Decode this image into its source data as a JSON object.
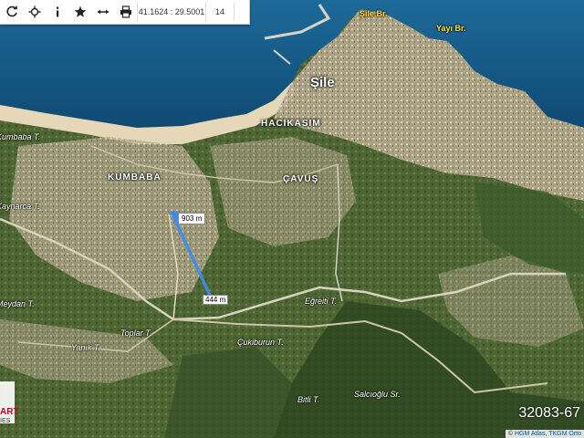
{
  "toolbar": {
    "buttons": [
      {
        "name": "refresh-icon"
      },
      {
        "name": "locate-icon"
      },
      {
        "name": "info-icon"
      },
      {
        "name": "favorite-icon"
      },
      {
        "name": "measure-icon"
      },
      {
        "name": "print-icon"
      }
    ],
    "coordinates": "41.1624 : 29.5001",
    "zoom": "14"
  },
  "map": {
    "town_label": "Şile",
    "sea_labels": [
      "Şile Br.",
      "Yayı Br."
    ],
    "districts": [
      "HACIKASIM",
      "KUMBABA",
      "ÇAVUŞ"
    ],
    "places": [
      "Kumbaba T.",
      "Kaynarca T.",
      "Meydan T.",
      "Toplar T.",
      "Eğreiti T.",
      "Çukiburun T.",
      "Yanık T.",
      "Bitli T.",
      "Salcıoğlu Sr."
    ],
    "measurement": {
      "segment_label": "903 m",
      "end_label": "444 m"
    },
    "listing_watermark": "32083-67",
    "logo_text": "ART",
    "logo_sub": "IES",
    "attribution": {
      "copyright": "©",
      "hgm": "HGM Atlas",
      "tkgm": "TKGM Orto"
    }
  },
  "colors": {
    "sea": "#1a5f8a",
    "land": "#5a6e3e",
    "urban": "#b8aa90",
    "beach": "#e8dcc0",
    "measure": "#3c8cf0"
  }
}
